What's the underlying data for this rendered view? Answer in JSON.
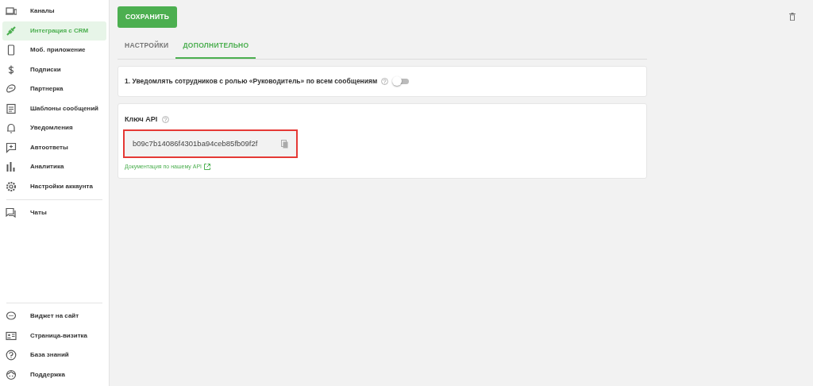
{
  "sidebar": {
    "items": [
      {
        "label": "Каналы",
        "selected": false
      },
      {
        "label": "Интеграция с CRM",
        "selected": true
      },
      {
        "label": "Моб. приложение",
        "selected": false
      },
      {
        "label": "Подписки",
        "selected": false
      },
      {
        "label": "Партнерка",
        "selected": false
      },
      {
        "label": "Шаблоны сообщений",
        "selected": false
      },
      {
        "label": "Уведомления",
        "selected": false
      },
      {
        "label": "Автоответы",
        "selected": false
      },
      {
        "label": "Аналитика",
        "selected": false
      },
      {
        "label": "Настройки аккаунта",
        "selected": false
      },
      {
        "label": "Чаты",
        "selected": false
      }
    ],
    "bottom_items": [
      {
        "label": "Виджет на сайт"
      },
      {
        "label": "Страница-визитка"
      },
      {
        "label": "База знаний"
      },
      {
        "label": "Поддержка"
      }
    ]
  },
  "save_button": "СОХРАНИТЬ",
  "tabs": [
    {
      "label": "НАСТРОЙКИ",
      "selected": false
    },
    {
      "label": "ДОПОЛНИТЕЛЬНО",
      "selected": true
    }
  ],
  "notify_setting": {
    "label": "1. Уведомлять сотрудников с ролью «Руководитель» по всем сообщениям",
    "on": false
  },
  "api": {
    "title": "Ключ API",
    "key": "b09c7b14086f4301ba94ceb85fb09f2f",
    "highlighted": true,
    "docs_link": "Документация по нашему API"
  }
}
